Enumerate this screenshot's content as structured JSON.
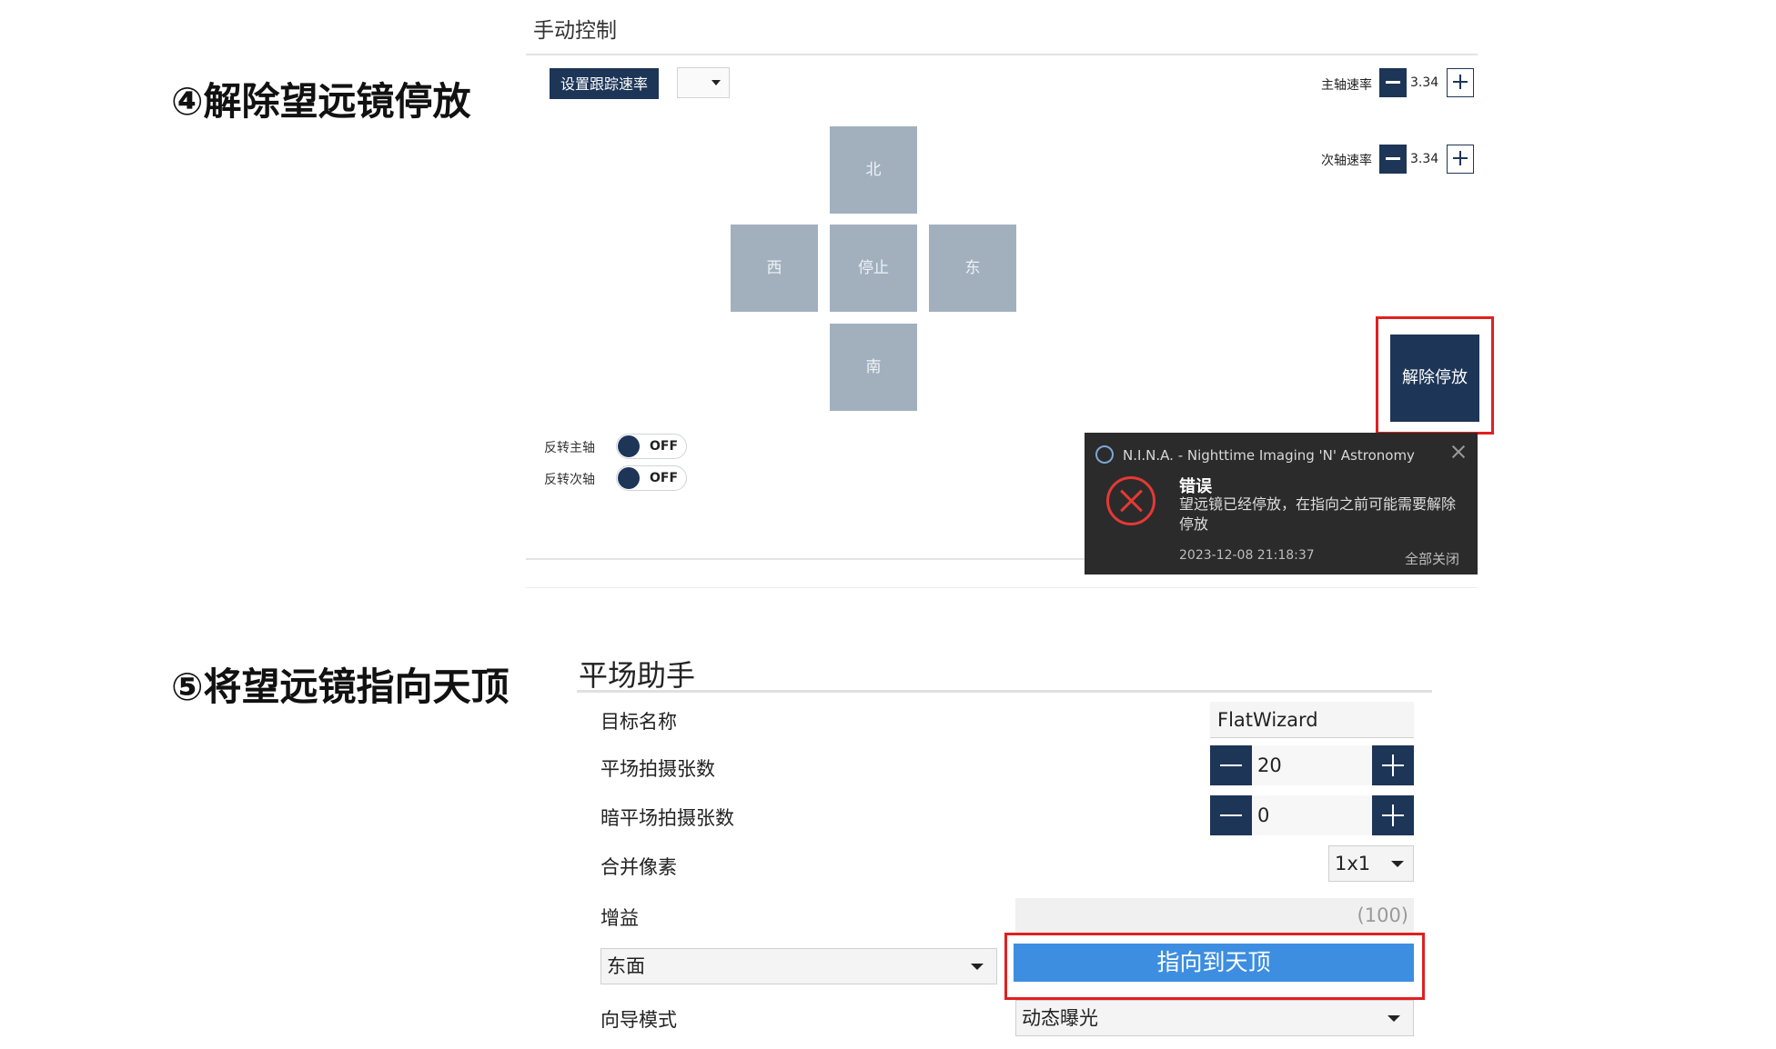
{
  "step4": {
    "title": "④解除望远镜停放"
  },
  "step5": {
    "title": "⑤将望远镜指向天顶"
  },
  "manual_control": {
    "title": "手动控制",
    "set_tracking_rate_label": "设置跟踪速率",
    "tracking_rate_selected": "",
    "primary_rate": {
      "label": "主轴速率",
      "value": "3.34"
    },
    "secondary_rate": {
      "label": "次轴速率",
      "value": "3.34"
    },
    "directions": {
      "north": "北",
      "west": "西",
      "stop": "停止",
      "east": "东",
      "south": "南"
    },
    "unpark_label": "解除停放",
    "reverse_primary": {
      "label": "反转主轴",
      "state": "OFF"
    },
    "reverse_secondary": {
      "label": "反转次轴",
      "state": "OFF"
    },
    "notification": {
      "app_name": "N.I.N.A. - Nighttime Imaging 'N' Astronomy",
      "title": "错误",
      "message": "望远镜已经停放，在指向之前可能需要解除停放",
      "timestamp": "2023-12-08 21:18:37",
      "close_all_label": "全部关闭"
    }
  },
  "flat_wizard": {
    "title": "平场助手",
    "target_name": {
      "label": "目标名称",
      "value": "FlatWizard"
    },
    "flat_count": {
      "label": "平场拍摄张数",
      "value": "20"
    },
    "dark_flat_count": {
      "label": "暗平场拍摄张数",
      "value": "0"
    },
    "binning": {
      "label": "合并像素",
      "value": "1x1"
    },
    "gain": {
      "label": "增益",
      "value": "(100)"
    },
    "side_select": {
      "value": "东面"
    },
    "point_zenith_label": "指向到天顶",
    "wizard_mode": {
      "label": "向导模式",
      "value": "动态曝光"
    }
  },
  "colors": {
    "navy": "#1d3557",
    "direction_pad": "#a2b0be",
    "highlight_red": "#e02020",
    "accent_blue": "#3d8ee0",
    "toast_bg": "#2b2b2b"
  }
}
